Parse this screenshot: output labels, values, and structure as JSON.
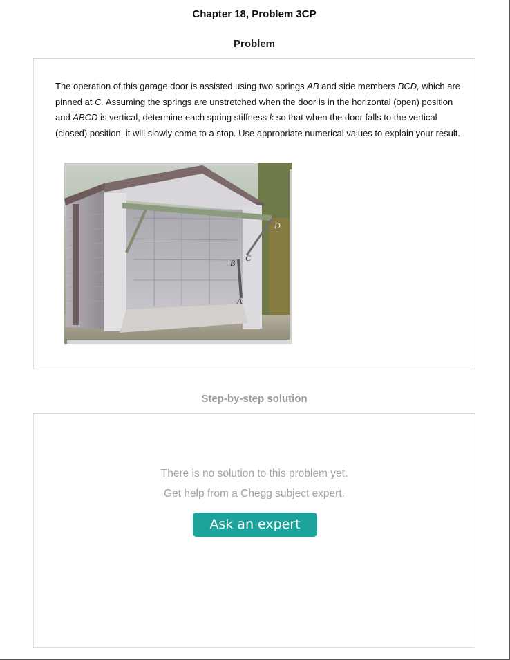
{
  "header": {
    "chapter_title": "Chapter 18, Problem 3CP",
    "problem_heading": "Problem"
  },
  "problem": {
    "text_parts": [
      "The operation of this garage door is assisted using two springs ",
      "AB",
      " and side members ",
      "BCD,",
      " which are pinned at ",
      "C.",
      " Assuming the springs are unstretched when the door is in the horizontal (open) position and ",
      "ABCD",
      " is vertical, determine each spring stiffness ",
      "k",
      " so that when the door falls to the vertical (closed) position, it will slowly come to a stop. Use appropriate numerical values to explain your result."
    ],
    "figure_labels": {
      "d": "D",
      "c": "C",
      "b": "B",
      "a": "A"
    }
  },
  "solution": {
    "heading": "Step-by-step solution",
    "no_solution_text": "There is no solution to this problem yet.",
    "help_text": "Get help from a Chegg subject expert.",
    "ask_button_label": "Ask an expert"
  },
  "colors": {
    "accent_button": "#1ba39c",
    "muted_text": "#a3a3a3"
  }
}
